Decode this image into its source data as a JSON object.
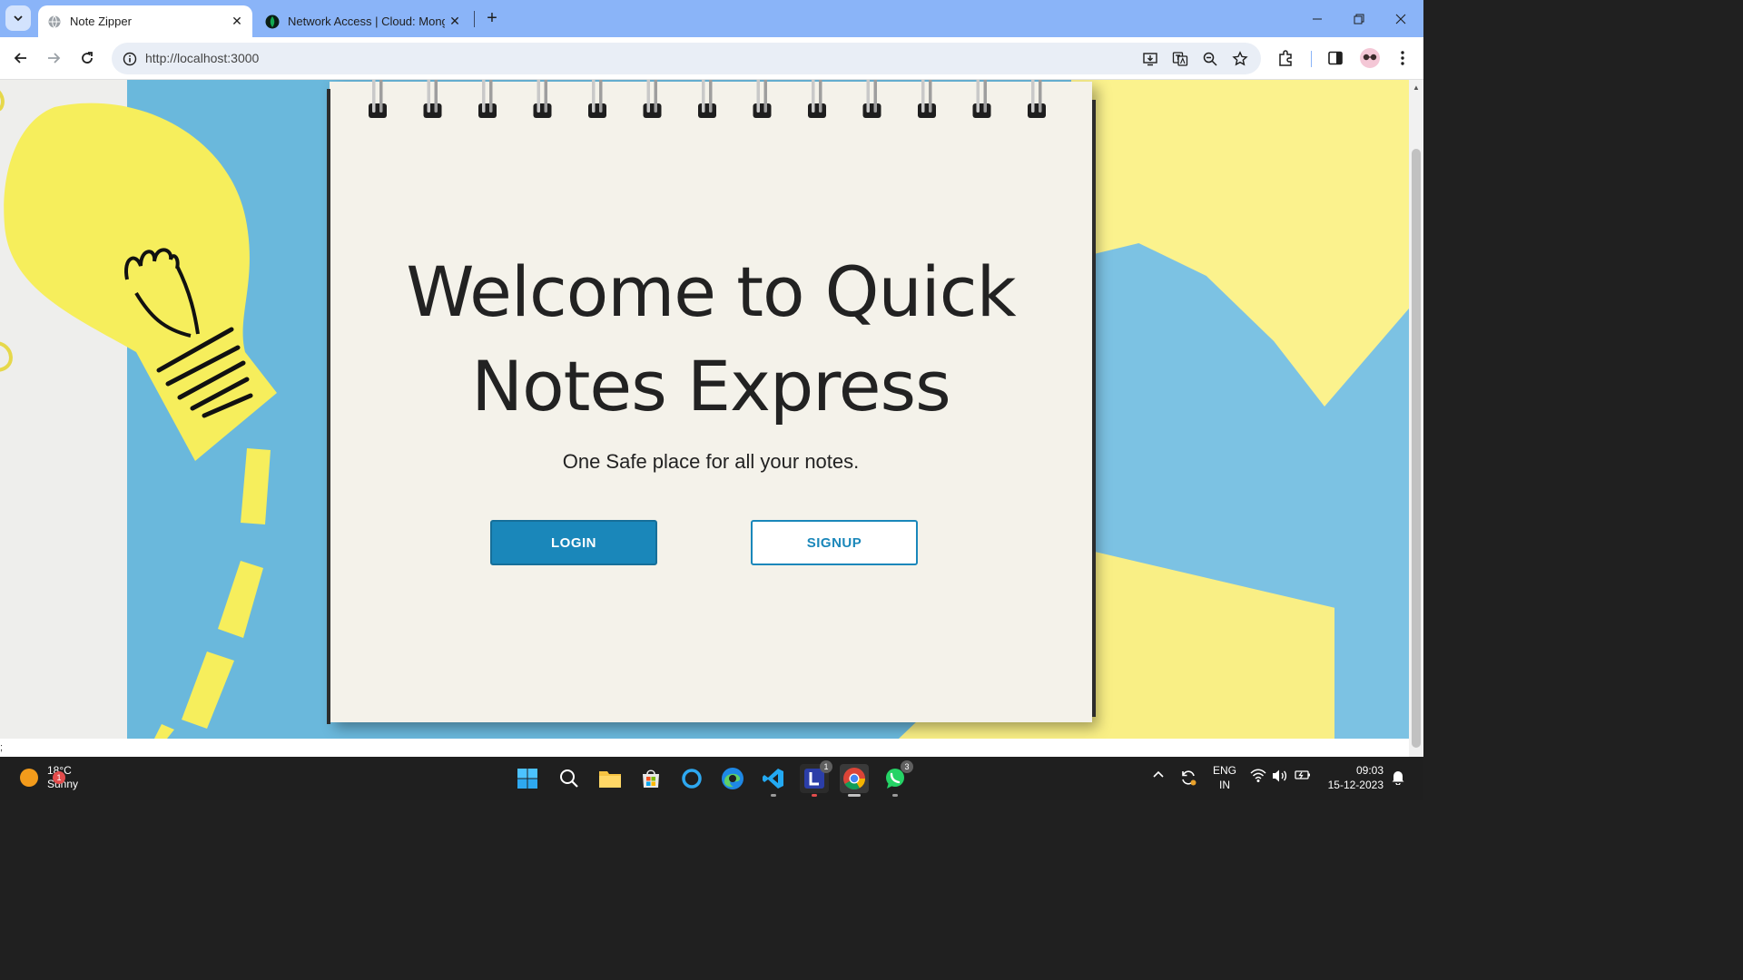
{
  "browser": {
    "tabs": [
      {
        "title": "Note Zipper",
        "active": true
      },
      {
        "title": "Network Access | Cloud: MongoDB",
        "active": false
      }
    ],
    "url": "http://localhost:3000"
  },
  "hero": {
    "headline_line1": "Welcome to Quick",
    "headline_line2": "Notes Express",
    "tagline": "One Safe place for all your notes.",
    "login_label": "LOGIN",
    "signup_label": "SIGNUP"
  },
  "page": {
    "stray_text": ";"
  },
  "taskbar": {
    "weather_temp": "18°C",
    "weather_desc": "Sunny",
    "weather_badge": "1",
    "apps": [
      {
        "name": "start",
        "badge": ""
      },
      {
        "name": "search",
        "badge": ""
      },
      {
        "name": "file-explorer",
        "badge": ""
      },
      {
        "name": "microsoft-store",
        "badge": ""
      },
      {
        "name": "cortana",
        "badge": ""
      },
      {
        "name": "edge",
        "badge": ""
      },
      {
        "name": "vscode",
        "badge": ""
      },
      {
        "name": "app-l",
        "badge": "1"
      },
      {
        "name": "chrome",
        "badge": ""
      },
      {
        "name": "whatsapp",
        "badge": "3"
      }
    ],
    "lang_line1": "ENG",
    "lang_line2": "IN",
    "time": "09:03",
    "date": "15-12-2023"
  },
  "colors": {
    "accent": "#1a87ba",
    "tabstrip": "#8ab4f8"
  }
}
